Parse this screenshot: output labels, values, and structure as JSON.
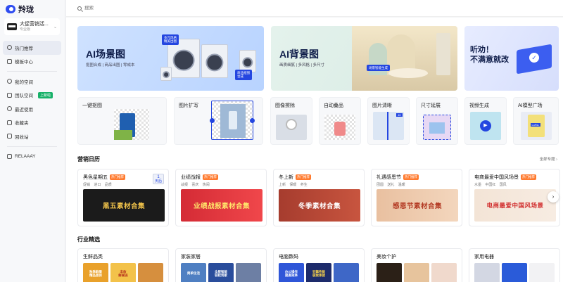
{
  "app": {
    "name": "羚珑"
  },
  "org": {
    "name": "大促营销活...",
    "plan": "专业版"
  },
  "nav": {
    "items": [
      {
        "label": "热门推荐",
        "active": true
      },
      {
        "label": "模板中心"
      },
      {
        "label": "我的空间"
      },
      {
        "label": "团队空间",
        "badge": "上新啦"
      },
      {
        "label": "最近使用"
      },
      {
        "label": "收藏夹"
      },
      {
        "label": "回收站"
      }
    ],
    "footer": "RELAAAY"
  },
  "search": {
    "placeholder": "搜索"
  },
  "banners": [
    {
      "title": "AI场景图",
      "subtitle": "抠图合成 | 商品出图 | 零成本",
      "tag1": "多元风格\n精美出图",
      "tag2": "商品抠图\n合成"
    },
    {
      "title": "AI背景图",
      "subtitle": "画质细腻 | 多风格 | 多尺寸",
      "tag1": "场景智能生成"
    },
    {
      "title": "听劝！\n不满意就改"
    }
  ],
  "tools": [
    {
      "label": "一键抠图"
    },
    {
      "label": "图片扩写"
    },
    {
      "label": "图像擦除"
    },
    {
      "label": "自动叠品"
    },
    {
      "label": "图片清晰"
    },
    {
      "label": "尺寸延展"
    },
    {
      "label": "视频生成"
    },
    {
      "label": "AI模型广场"
    }
  ],
  "calendar": {
    "title": "营销日历",
    "link": "全部专题",
    "date_num": "1",
    "date_label": "天后",
    "cards": [
      {
        "title": "黑色星期五",
        "badge": "热门推荐",
        "tags": "促销 进口 品质",
        "banner": "黑五素材合集",
        "bg": "#1b1b1b",
        "fg": "#f2c44b"
      },
      {
        "title": "业绩战报",
        "badge": "热门推荐",
        "tags": "战报 喜庆 热闹",
        "banner": "业绩战报素材合集",
        "bg": "#e8363f",
        "fg": "#ffe66b"
      },
      {
        "title": "冬上新",
        "badge": "热门推荐",
        "tags": "上新 保暖 养生",
        "banner": "冬季素材合集",
        "bg": "#b84838",
        "fg": "#ffffff"
      },
      {
        "title": "礼遇感恩节",
        "badge": "热门推荐",
        "tags": "团圆 送礼 温暖",
        "banner": "感恩节素材合集",
        "bg": "#e9c0a0",
        "fg": "#b33a23"
      },
      {
        "title": "电商最爱中国风场景",
        "badge": "热门推荐",
        "tags": "水墨 中国红 国风",
        "banner": "电商最爱中国风场景",
        "bg": "#f3e4d6",
        "fg": "#d12c2c"
      }
    ]
  },
  "industry": {
    "title": "行业精选",
    "cards": [
      {
        "title": "生鲜品类",
        "thumbs": [
          {
            "text": "秋季鲜果\n精品直供",
            "bg": "#e9a12b"
          },
          {
            "text": "丰收\n鲜果派",
            "bg": "#f3c24a"
          },
          {
            "text": "",
            "bg": "#d68f3e"
          }
        ]
      },
      {
        "title": "家装家居",
        "thumbs": [
          {
            "text": "简单生活",
            "bg": "#4f7fc2"
          },
          {
            "text": "全屋智能\n轻松到家",
            "bg": "#2a4d9c"
          },
          {
            "text": "",
            "bg": "#6d7fa4"
          }
        ]
      },
      {
        "title": "电脑数码",
        "thumbs": [
          {
            "text": "办公操作\n提高效率",
            "bg": "#2f56d8"
          },
          {
            "text": "狂飙性能\n极致体验",
            "bg": "#1d2b6b"
          },
          {
            "text": "",
            "bg": "#3e67c7"
          }
        ]
      },
      {
        "title": "美妆个护",
        "thumbs": [
          {
            "text": "",
            "bg": "#2b2017"
          },
          {
            "text": "",
            "bg": "#e7c49d"
          },
          {
            "text": "",
            "bg": "#f0d9cc"
          }
        ]
      },
      {
        "title": "家用电器",
        "thumbs": [
          {
            "text": "",
            "bg": "#d3d7e3"
          },
          {
            "text": "",
            "bg": "#2a5bd9"
          },
          {
            "text": "",
            "bg": "#f2f2f4"
          }
        ]
      }
    ]
  }
}
